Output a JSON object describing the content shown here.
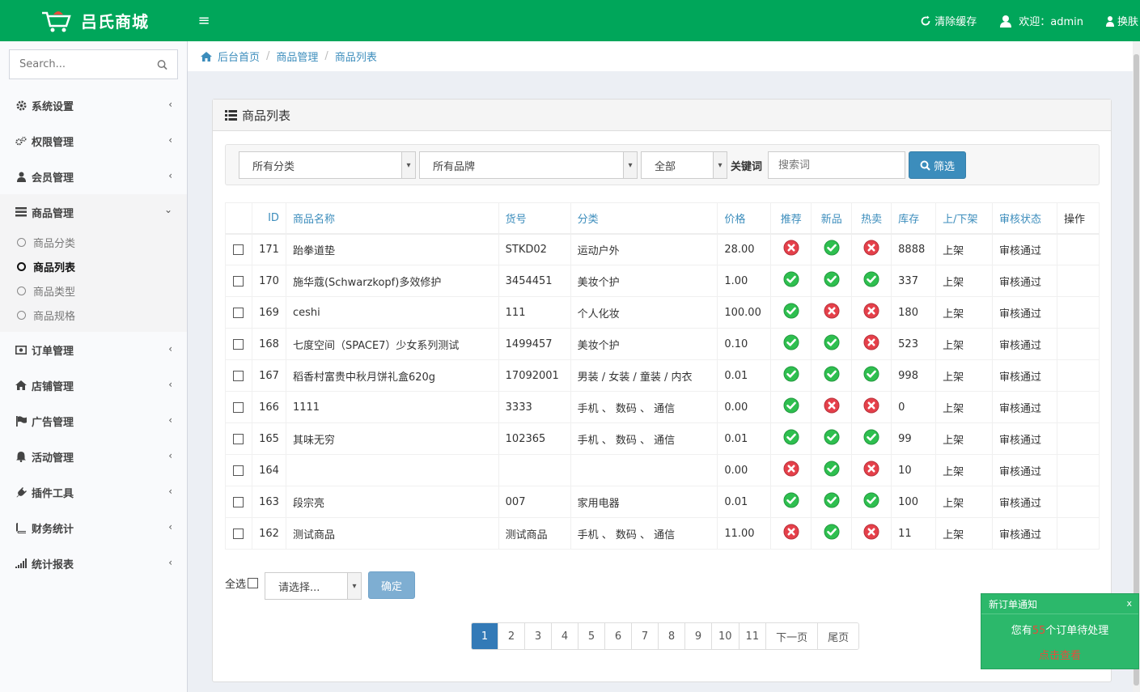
{
  "brand": {
    "title": "吕氏商城"
  },
  "topbar": {
    "clear_cache": "清除缓存",
    "welcome": "欢迎：admin",
    "skin": "换肤"
  },
  "sidebar": {
    "search_placeholder": "Search...",
    "items": [
      {
        "label": "系统设置",
        "icon": "gear-icon"
      },
      {
        "label": "权限管理",
        "icon": "gears-icon"
      },
      {
        "label": "会员管理",
        "icon": "user-icon"
      },
      {
        "label": "商品管理",
        "icon": "list-icon"
      },
      {
        "label": "订单管理",
        "icon": "money-icon"
      },
      {
        "label": "店铺管理",
        "icon": "home-icon"
      },
      {
        "label": "广告管理",
        "icon": "flag-icon"
      },
      {
        "label": "活动管理",
        "icon": "bell-icon"
      },
      {
        "label": "插件工具",
        "icon": "plug-icon"
      },
      {
        "label": "财务统计",
        "icon": "book-icon"
      },
      {
        "label": "统计报表",
        "icon": "signal-icon"
      }
    ],
    "submenu": [
      "商品分类",
      "商品列表",
      "商品类型",
      "商品规格"
    ]
  },
  "breadcrumb": [
    "后台首页",
    "商品管理",
    "商品列表"
  ],
  "panel": {
    "title": "商品列表"
  },
  "filter": {
    "category": "所有分类",
    "brand": "所有品牌",
    "scope": "全部",
    "keyword_label": "关键词",
    "keyword_placeholder": "搜索词",
    "button": "筛选"
  },
  "table": {
    "headers": [
      "ID",
      "商品名称",
      "货号",
      "分类",
      "价格",
      "推荐",
      "新品",
      "热卖",
      "库存",
      "上/下架",
      "审核状态",
      "操作"
    ],
    "rows": [
      {
        "id": "171",
        "name": "跆拳道垫",
        "sn": "STKD02",
        "cat": "运动户外",
        "price": "28.00",
        "rec": false,
        "new": true,
        "hot": false,
        "stock": "8888",
        "shelf": "上架",
        "audit": "审核通过"
      },
      {
        "id": "170",
        "name": "施华蔻(Schwarzkopf)多效修护",
        "sn": "3454451",
        "cat": "美妆个护",
        "price": "1.00",
        "rec": true,
        "new": true,
        "hot": true,
        "stock": "337",
        "shelf": "上架",
        "audit": "审核通过"
      },
      {
        "id": "169",
        "name": "ceshi",
        "sn": "111",
        "cat": "个人化妆",
        "price": "100.00",
        "rec": true,
        "new": false,
        "hot": false,
        "stock": "180",
        "shelf": "上架",
        "audit": "审核通过"
      },
      {
        "id": "168",
        "name": "七度空间（SPACE7）少女系列测试",
        "sn": "1499457",
        "cat": "美妆个护",
        "price": "0.10",
        "rec": true,
        "new": true,
        "hot": false,
        "stock": "523",
        "shelf": "上架",
        "audit": "审核通过"
      },
      {
        "id": "167",
        "name": "稻香村富贵中秋月饼礼盒620g",
        "sn": "17092001",
        "cat": "男装 / 女装 / 童装 / 内衣",
        "price": "0.01",
        "rec": true,
        "new": true,
        "hot": true,
        "stock": "998",
        "shelf": "上架",
        "audit": "审核通过"
      },
      {
        "id": "166",
        "name": "1111",
        "sn": "3333",
        "cat": "手机 、 数码 、 通信",
        "price": "0.00",
        "rec": true,
        "new": false,
        "hot": false,
        "stock": "0",
        "shelf": "上架",
        "audit": "审核通过"
      },
      {
        "id": "165",
        "name": "其味无穷",
        "sn": "102365",
        "cat": "手机 、 数码 、 通信",
        "price": "0.01",
        "rec": true,
        "new": true,
        "hot": true,
        "stock": "99",
        "shelf": "上架",
        "audit": "审核通过"
      },
      {
        "id": "164",
        "name": "",
        "sn": "",
        "cat": "",
        "price": "0.00",
        "rec": false,
        "new": true,
        "hot": false,
        "stock": "10",
        "shelf": "上架",
        "audit": "审核通过"
      },
      {
        "id": "163",
        "name": "段宗亮",
        "sn": "007",
        "cat": "家用电器",
        "price": "0.01",
        "rec": true,
        "new": true,
        "hot": true,
        "stock": "100",
        "shelf": "上架",
        "audit": "审核通过"
      },
      {
        "id": "162",
        "name": "测试商品",
        "sn": "测试商品",
        "cat": "手机 、 数码 、 通信",
        "price": "11.00",
        "rec": false,
        "new": true,
        "hot": false,
        "stock": "11",
        "shelf": "上架",
        "audit": "审核通过"
      }
    ]
  },
  "bulk": {
    "select_all": "全选",
    "action": "请选择...",
    "confirm": "确定"
  },
  "pagination": {
    "pages": [
      "1",
      "2",
      "3",
      "4",
      "5",
      "6",
      "7",
      "8",
      "9",
      "10",
      "11"
    ],
    "active": "1",
    "next": "下一页",
    "last": "尾页"
  },
  "notification": {
    "title": "新订单通知",
    "close": "x",
    "prefix": "您有",
    "count": "55",
    "suffix": "个订单待处理",
    "link": "点击查看"
  },
  "colors": {
    "header": "#00a65a",
    "accent": "#3c8dbc",
    "ok": "#2ecc40",
    "bad": "#e74c3c"
  }
}
